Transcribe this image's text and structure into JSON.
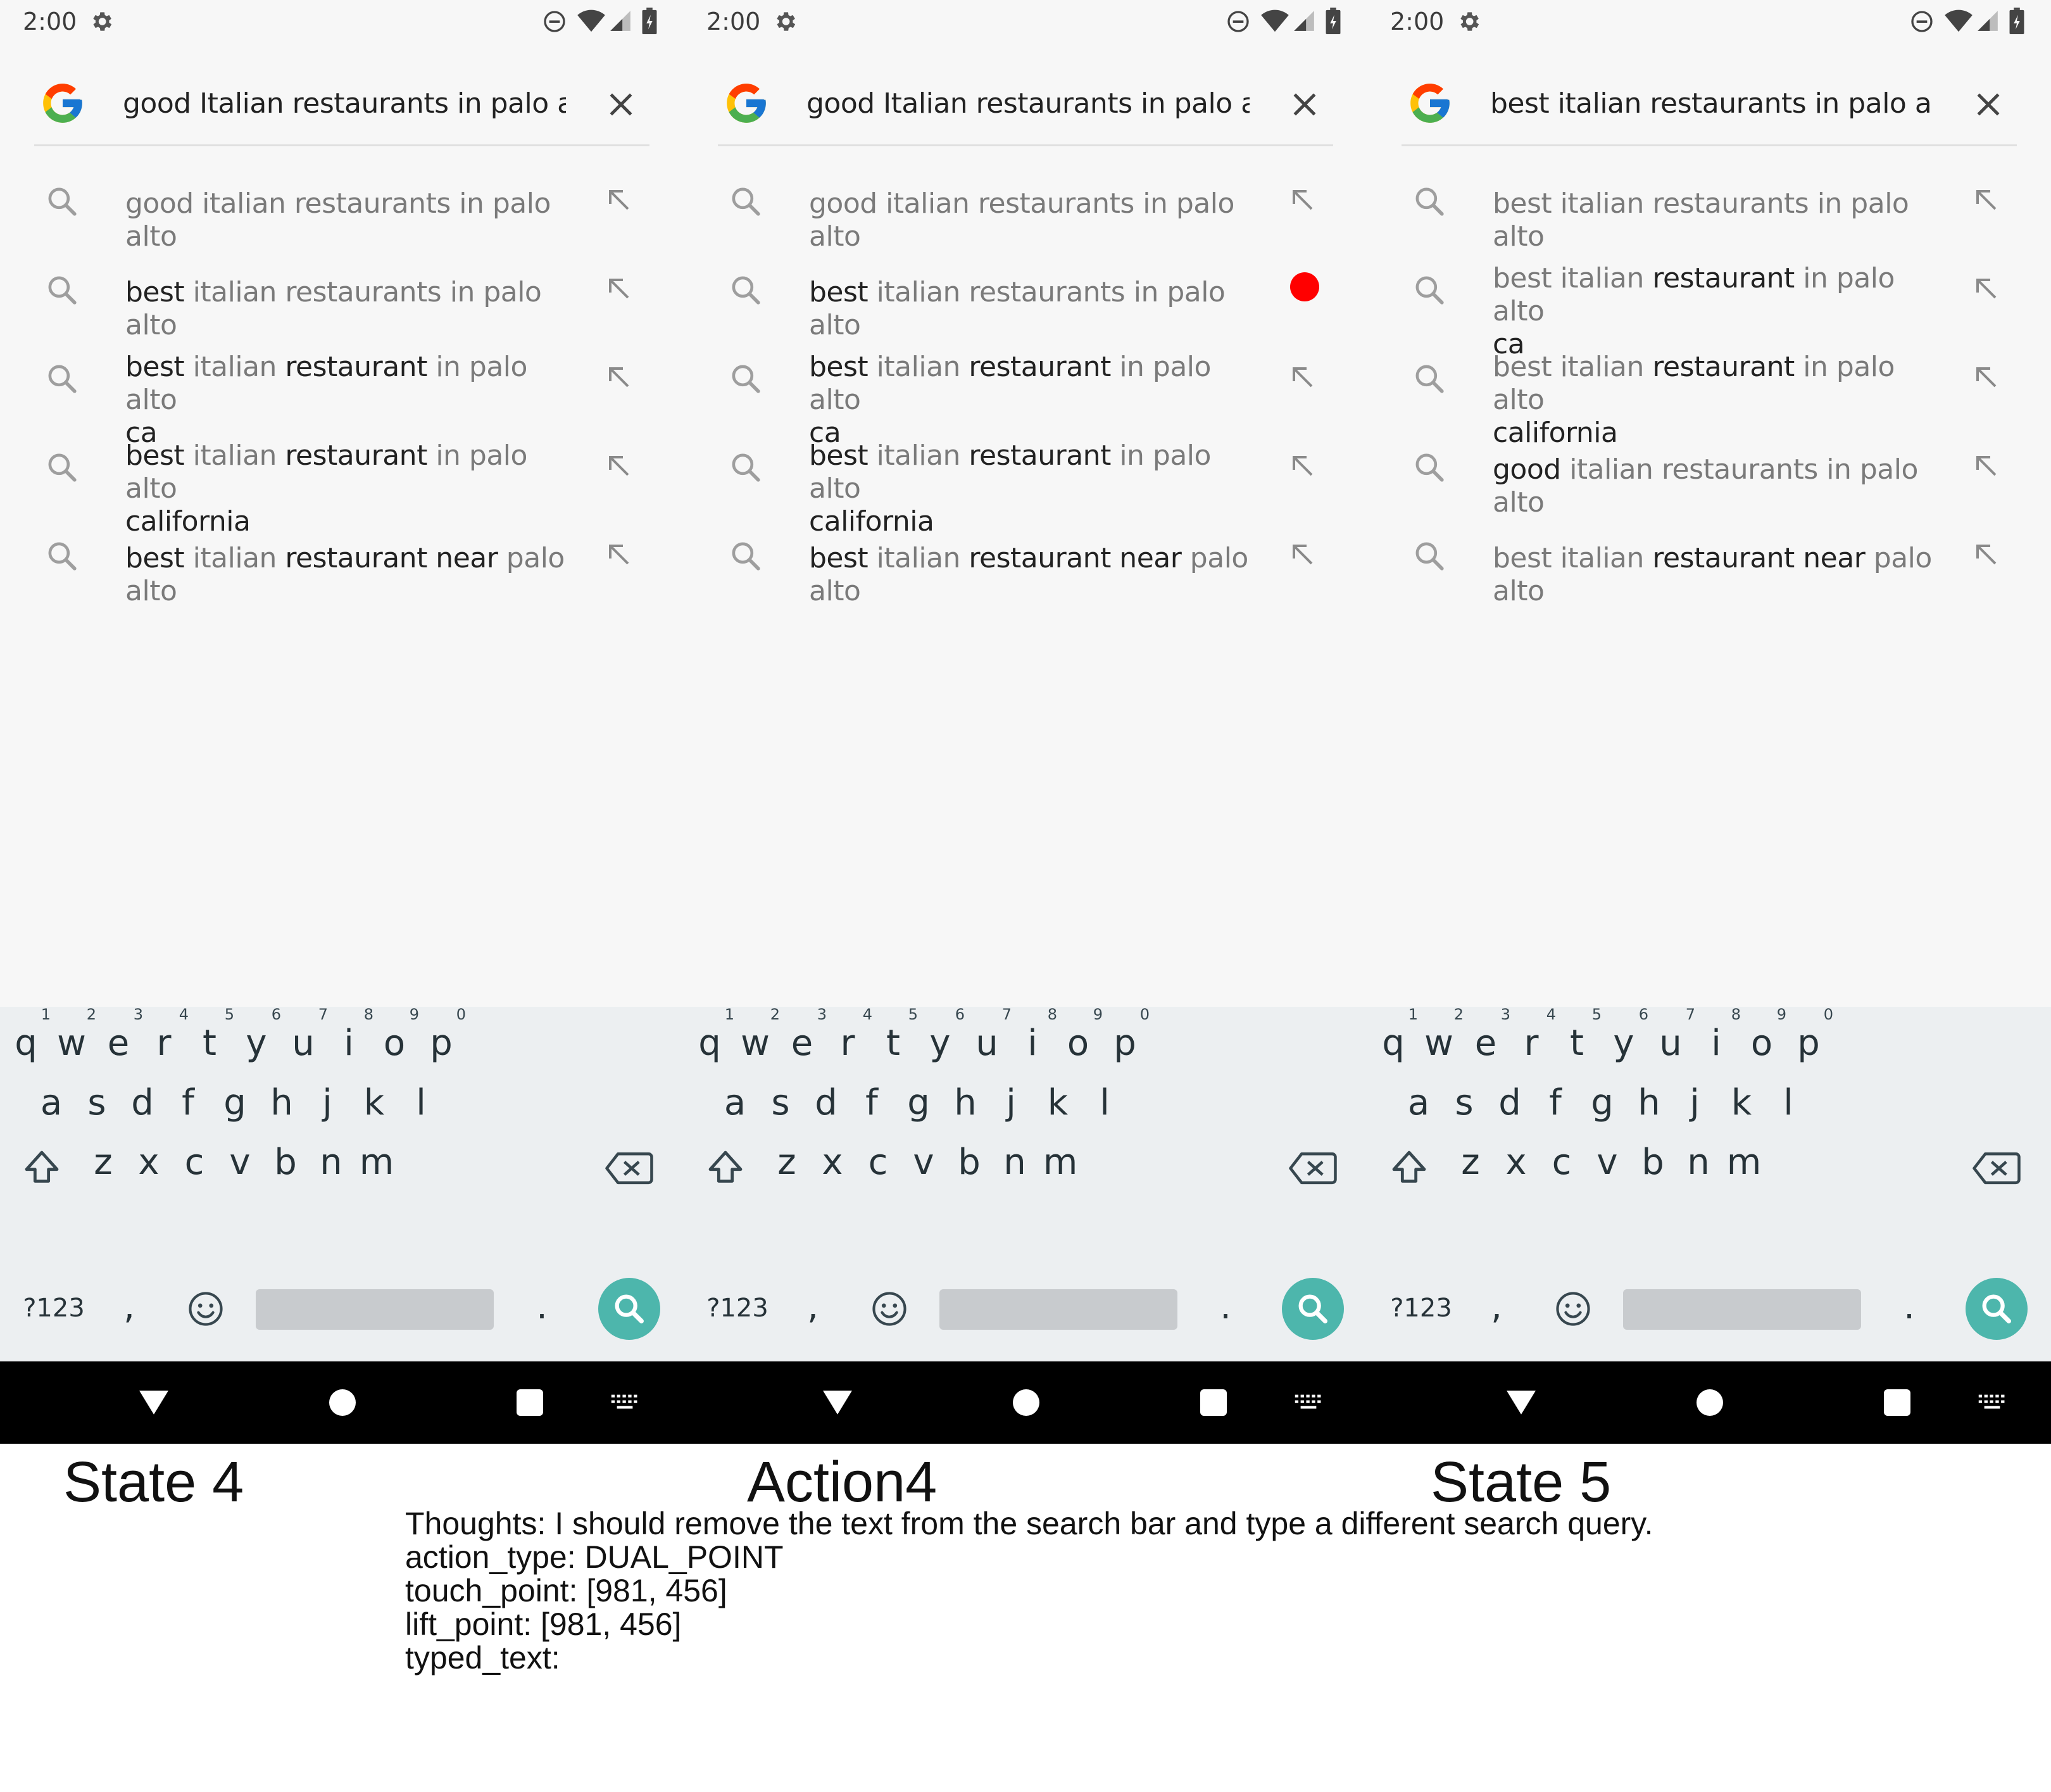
{
  "panels": [
    {
      "status_time": "2:00",
      "search_text": "good Italian restaurants in palo alto",
      "suggestions": [
        {
          "bold": "",
          "dim": "good italian restaurants in palo alto",
          "line2": ""
        },
        {
          "bold": "best",
          "dim": " italian restaurants in palo alto",
          "line2": ""
        },
        {
          "bold": "best",
          "dim": " italian ",
          "bold2": "restaurant",
          "dim2": " in palo alto",
          "line2": "ca"
        },
        {
          "bold": "best",
          "dim": " italian ",
          "bold2": "restaurant",
          "dim2": " in palo alto",
          "line2": "california"
        },
        {
          "bold": "best",
          "dim": " italian ",
          "bold2": "restaurant near",
          "dim2": " palo alto",
          "line2": ""
        }
      ]
    },
    {
      "status_time": "2:00",
      "search_text": "good Italian restaurants in palo alto",
      "suggestions": [
        {
          "bold": "",
          "dim": "good italian restaurants in palo alto",
          "line2": ""
        },
        {
          "bold": "best",
          "dim": " italian restaurants in palo alto",
          "line2": ""
        },
        {
          "bold": "best",
          "dim": " italian ",
          "bold2": "restaurant",
          "dim2": " in palo alto",
          "line2": "ca"
        },
        {
          "bold": "best",
          "dim": " italian ",
          "bold2": "restaurant",
          "dim2": " in palo alto",
          "line2": "california"
        },
        {
          "bold": "best",
          "dim": " italian ",
          "bold2": "restaurant near",
          "dim2": " palo alto",
          "line2": ""
        }
      ]
    },
    {
      "status_time": "2:00",
      "search_text": "best italian restaurants in palo alto",
      "suggestions": [
        {
          "bold": "",
          "dim": "best italian restaurants in palo alto",
          "line2": ""
        },
        {
          "bold": "",
          "dim": "best italian ",
          "bold2": "restaurant",
          "dim2": " in palo alto",
          "line2": "ca"
        },
        {
          "bold": "",
          "dim": "best italian ",
          "bold2": "restaurant",
          "dim2": " in palo alto",
          "line2": "california"
        },
        {
          "bold": "good",
          "dim": " italian restaurants in palo alto",
          "line2": ""
        },
        {
          "bold": "",
          "dim": "best italian ",
          "bold2": "restaurant near",
          "dim2": " palo alto",
          "line2": ""
        }
      ]
    }
  ],
  "keyboard": {
    "row1": [
      "q",
      "w",
      "e",
      "r",
      "t",
      "y",
      "u",
      "i",
      "o",
      "p"
    ],
    "row1_hints": [
      "1",
      "2",
      "3",
      "4",
      "5",
      "6",
      "7",
      "8",
      "9",
      "0"
    ],
    "row2": [
      "a",
      "s",
      "d",
      "f",
      "g",
      "h",
      "j",
      "k",
      "l"
    ],
    "row3": [
      "z",
      "x",
      "c",
      "v",
      "b",
      "n",
      "m"
    ],
    "symbols_label": "?123",
    "comma": ",",
    "period": "."
  },
  "captions": {
    "state_before": "State 4",
    "action": "Action4",
    "state_after": "State 5"
  },
  "action": {
    "thoughts": "Thoughts: I should remove the text from the search bar and type a different search query.",
    "action_type": "action_type: DUAL_POINT",
    "touch_point": "touch_point: [981, 456]",
    "lift_point": "lift_point: [981, 456]",
    "typed_text": "typed_text:"
  },
  "colors": {
    "search_key": "#4db6ac",
    "caret": "#4a7de8",
    "tap_marker": "#ff0000"
  }
}
